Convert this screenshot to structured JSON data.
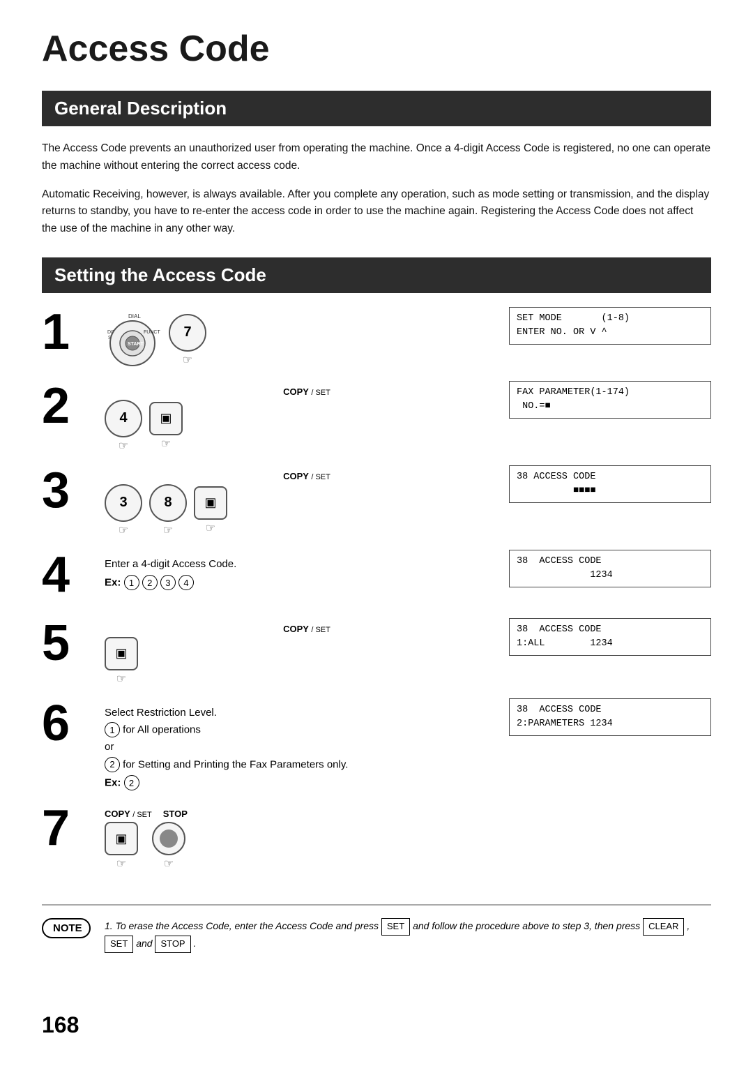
{
  "page": {
    "title": "Access Code",
    "page_number": "168",
    "sections": {
      "general": {
        "header": "General Description",
        "paragraphs": [
          "The Access Code prevents an unauthorized user from operating the machine.  Once a 4-digit Access Code is registered, no one can operate the machine without entering the correct access code.",
          "Automatic Receiving, however, is always available.  After you complete any operation, such as mode setting or transmission, and the display returns to standby, you have to re-enter the access code in order to use the machine again.  Registering the Access Code does not affect the use of the machine in any other way."
        ]
      },
      "setting": {
        "header": "Setting the Access Code",
        "steps": [
          {
            "number": "1",
            "display": "SET MODE       (1-8)\nENTER NO. OR V ^"
          },
          {
            "number": "2",
            "copy_set": "COPY / SET",
            "keys": [
              "4"
            ],
            "display": "FAX PARAMETER(1-174)\n NO.=■"
          },
          {
            "number": "3",
            "copy_set": "COPY / SET",
            "keys": [
              "3",
              "8"
            ],
            "display": "38 ACCESS CODE\n          ■■■■"
          },
          {
            "number": "4",
            "text": "Enter a 4-digit Access Code.",
            "ex_label": "Ex:",
            "ex_keys": [
              "1",
              "2",
              "3",
              "4"
            ],
            "display": "38  ACCESS CODE\n             1234"
          },
          {
            "number": "5",
            "copy_set": "COPY / SET",
            "display": "38  ACCESS CODE\n1:ALL        1234"
          },
          {
            "number": "6",
            "text1": "Select Restriction Level.",
            "option1": "for All operations",
            "option1_num": "1",
            "or_text": "or",
            "option2": "for Setting and Printing the Fax Parameters only.",
            "option2_num": "2",
            "ex_label": "Ex:",
            "ex_val": "2",
            "display": "38  ACCESS CODE\n2:PARAMETERS 1234"
          },
          {
            "number": "7",
            "copy_set": "COPY / SET",
            "stop_label": "STOP",
            "display": null
          }
        ]
      }
    },
    "note": {
      "label": "NOTE",
      "text": "1.  To erase the Access Code, enter the Access Code and press",
      "set_key": "SET",
      "text2": "and follow the procedure above to step 3, then press",
      "clear_key": "CLEAR",
      "comma": ",",
      "set_key2": "SET",
      "and_text": "and",
      "stop_key": "STOP",
      "period": "."
    }
  }
}
